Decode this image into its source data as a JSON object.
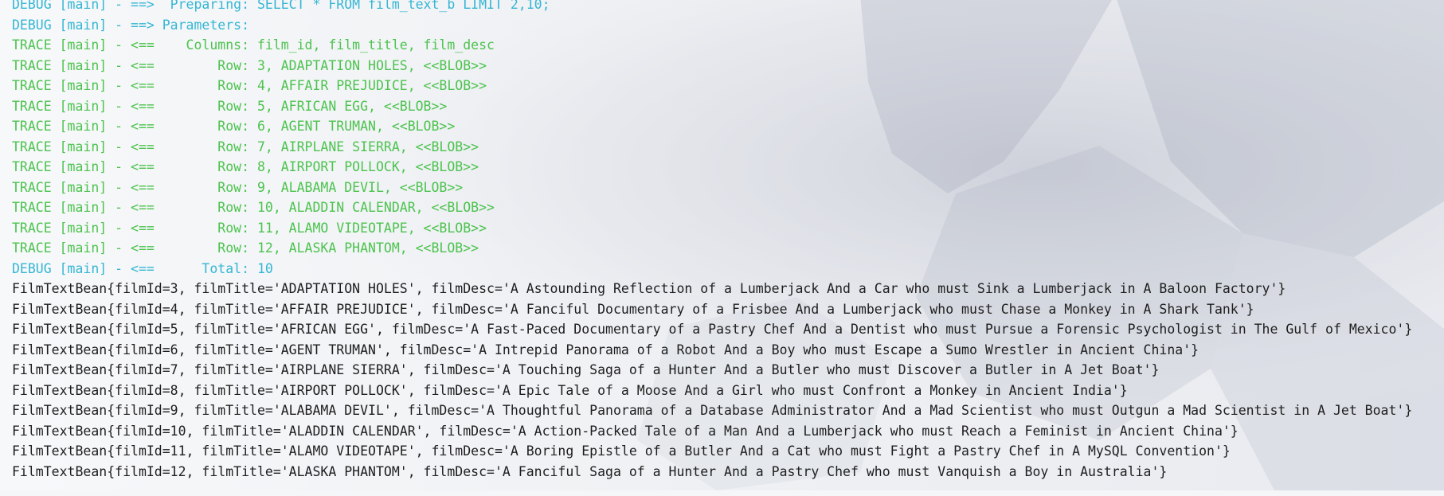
{
  "colors": {
    "debug": "#35b6d4",
    "trace": "#4cc34e",
    "stdout": "#1e1e1e",
    "background": "#f5f6f8"
  },
  "console": {
    "log_lines": [
      {
        "level": "debug",
        "text": "DEBUG [main] - ==>  Preparing: SELECT * FROM film_text_b LIMIT 2,10;"
      },
      {
        "level": "debug",
        "text": "DEBUG [main] - ==> Parameters: "
      },
      {
        "level": "trace",
        "text": "TRACE [main] - <==    Columns: film_id, film_title, film_desc"
      },
      {
        "level": "trace",
        "text": "TRACE [main] - <==        Row: 3, ADAPTATION HOLES, <<BLOB>>"
      },
      {
        "level": "trace",
        "text": "TRACE [main] - <==        Row: 4, AFFAIR PREJUDICE, <<BLOB>>"
      },
      {
        "level": "trace",
        "text": "TRACE [main] - <==        Row: 5, AFRICAN EGG, <<BLOB>>"
      },
      {
        "level": "trace",
        "text": "TRACE [main] - <==        Row: 6, AGENT TRUMAN, <<BLOB>>"
      },
      {
        "level": "trace",
        "text": "TRACE [main] - <==        Row: 7, AIRPLANE SIERRA, <<BLOB>>"
      },
      {
        "level": "trace",
        "text": "TRACE [main] - <==        Row: 8, AIRPORT POLLOCK, <<BLOB>>"
      },
      {
        "level": "trace",
        "text": "TRACE [main] - <==        Row: 9, ALABAMA DEVIL, <<BLOB>>"
      },
      {
        "level": "trace",
        "text": "TRACE [main] - <==        Row: 10, ALADDIN CALENDAR, <<BLOB>>"
      },
      {
        "level": "trace",
        "text": "TRACE [main] - <==        Row: 11, ALAMO VIDEOTAPE, <<BLOB>>"
      },
      {
        "level": "trace",
        "text": "TRACE [main] - <==        Row: 12, ALASKA PHANTOM, <<BLOB>>"
      },
      {
        "level": "debug",
        "text": "DEBUG [main] - <==      Total: 10"
      }
    ],
    "output_lines": [
      "FilmTextBean{filmId=3, filmTitle='ADAPTATION HOLES', filmDesc='A Astounding Reflection of a Lumberjack And a Car who must Sink a Lumberjack in A Baloon Factory'}",
      "FilmTextBean{filmId=4, filmTitle='AFFAIR PREJUDICE', filmDesc='A Fanciful Documentary of a Frisbee And a Lumberjack who must Chase a Monkey in A Shark Tank'}",
      "FilmTextBean{filmId=5, filmTitle='AFRICAN EGG', filmDesc='A Fast-Paced Documentary of a Pastry Chef And a Dentist who must Pursue a Forensic Psychologist in The Gulf of Mexico'}",
      "FilmTextBean{filmId=6, filmTitle='AGENT TRUMAN', filmDesc='A Intrepid Panorama of a Robot And a Boy who must Escape a Sumo Wrestler in Ancient China'}",
      "FilmTextBean{filmId=7, filmTitle='AIRPLANE SIERRA', filmDesc='A Touching Saga of a Hunter And a Butler who must Discover a Butler in A Jet Boat'}",
      "FilmTextBean{filmId=8, filmTitle='AIRPORT POLLOCK', filmDesc='A Epic Tale of a Moose And a Girl who must Confront a Monkey in Ancient India'}",
      "FilmTextBean{filmId=9, filmTitle='ALABAMA DEVIL', filmDesc='A Thoughtful Panorama of a Database Administrator And a Mad Scientist who must Outgun a Mad Scientist in A Jet Boat'}",
      "FilmTextBean{filmId=10, filmTitle='ALADDIN CALENDAR', filmDesc='A Action-Packed Tale of a Man And a Lumberjack who must Reach a Feminist in Ancient China'}",
      "FilmTextBean{filmId=11, filmTitle='ALAMO VIDEOTAPE', filmDesc='A Boring Epistle of a Butler And a Cat who must Fight a Pastry Chef in A MySQL Convention'}",
      "FilmTextBean{filmId=12, filmTitle='ALASKA PHANTOM', filmDesc='A Fanciful Saga of a Hunter And a Pastry Chef who must Vanquish a Boy in Australia'}"
    ]
  }
}
